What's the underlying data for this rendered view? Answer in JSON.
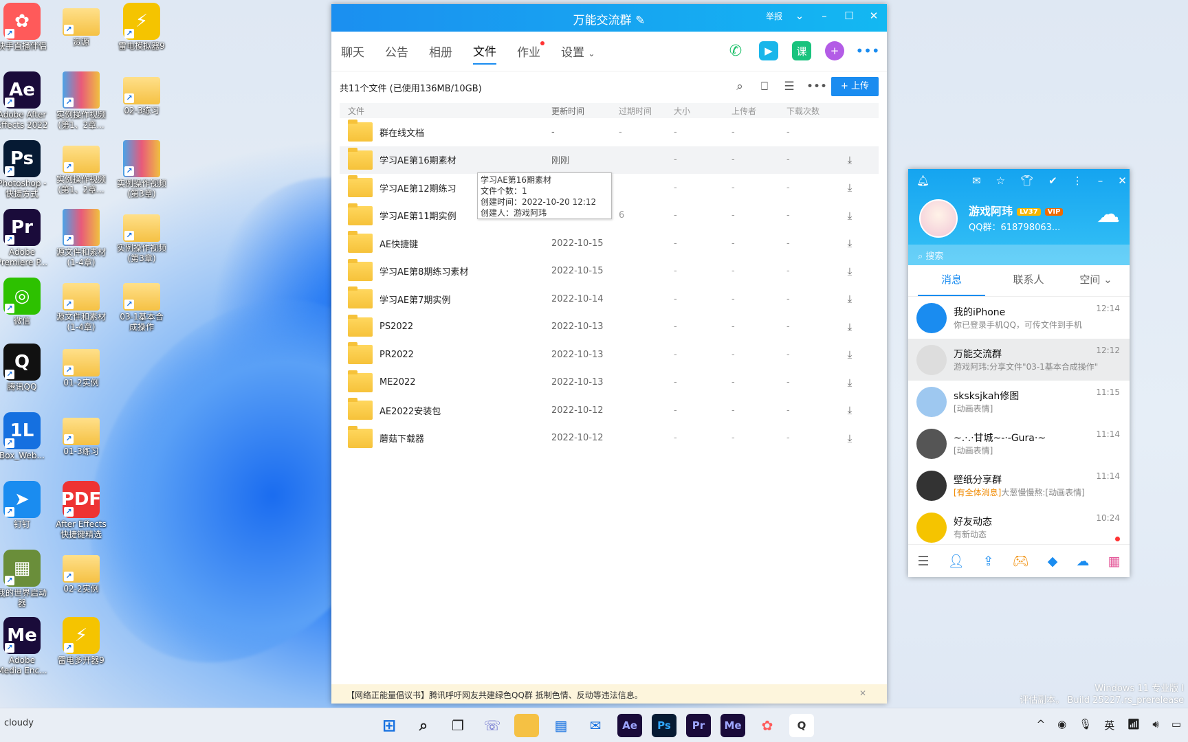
{
  "desktop": {
    "icons": [
      {
        "label": "快手直播伴侣",
        "glyph": "✿",
        "color": "#ff5a5a"
      },
      {
        "label": "资源",
        "glyph": "",
        "color": "folder"
      },
      {
        "label": "雷电模拟器9",
        "glyph": "⚡",
        "color": "#f5c400"
      },
      {
        "label": "Adobe After\nEffects 2022",
        "glyph": "Ae",
        "color": "#1a0b3a"
      },
      {
        "label": "实例操作视频\n(第1、2章...",
        "glyph": "",
        "color": "zip"
      },
      {
        "label": "02-3练习",
        "glyph": "",
        "color": "folder"
      },
      {
        "label": "Photoshop -\n快捷方式",
        "glyph": "Ps",
        "color": "#061a33"
      },
      {
        "label": "实例操作视频\n(第1、2章...",
        "glyph": "",
        "color": "folder"
      },
      {
        "label": "实例操作视频\n(第3章)",
        "glyph": "",
        "color": "zip"
      },
      {
        "label": "Adobe\nPremiere P...",
        "glyph": "Pr",
        "color": "#1a0b3a"
      },
      {
        "label": "源文件和素材\n(1-4章)",
        "glyph": "",
        "color": "zip"
      },
      {
        "label": "实例操作视频\n(第3章)",
        "glyph": "",
        "color": "folder"
      },
      {
        "label": "微信",
        "glyph": "◎",
        "color": "#2dc100"
      },
      {
        "label": "源文件和素材\n(1-4章)",
        "glyph": "",
        "color": "folder"
      },
      {
        "label": "03-1基本合\n成操作",
        "glyph": "",
        "color": "folder"
      },
      {
        "label": "腾讯QQ",
        "glyph": "Q",
        "color": "#111"
      },
      {
        "label": "01-2实例",
        "glyph": "",
        "color": "folder"
      },
      {
        "label": "Box_Web...",
        "glyph": "1L",
        "color": "#1570e0"
      },
      {
        "label": "01-3练习",
        "glyph": "",
        "color": "folder"
      },
      {
        "label": "钉钉",
        "glyph": "➤",
        "color": "#1a8cf0"
      },
      {
        "label": "After Effects\n快捷键精选",
        "glyph": "PDF",
        "color": "#e33"
      },
      {
        "label": "我的世界启动\n器",
        "glyph": "▦",
        "color": "#6a8e3a"
      },
      {
        "label": "02-2实例",
        "glyph": "",
        "color": "folder"
      },
      {
        "label": "Adobe\nMedia Enc...",
        "glyph": "Me",
        "color": "#1a0b3a"
      },
      {
        "label": "雷电多开器9",
        "glyph": "⚡",
        "color": "#f5c400"
      }
    ]
  },
  "window": {
    "title": "万能交流群",
    "report": "举报",
    "tabs": [
      "聊天",
      "公告",
      "相册",
      "文件",
      "作业",
      "设置"
    ],
    "active_tab": "文件",
    "file_count": "共11个文件 (已使用136MB/10GB)",
    "upload_label": "+ 上传",
    "headers": [
      "文件",
      "更新时间",
      "过期时间",
      "大小",
      "上传者",
      "下载次数"
    ],
    "files": [
      {
        "name": "群在线文档",
        "time": "-",
        "expire": "-",
        "size": "-",
        "uploader": "-",
        "downloads": "-",
        "dl": ""
      },
      {
        "name": "学习AE第16期素材",
        "time": "刚刚",
        "expire": "",
        "size": "-",
        "uploader": "-",
        "downloads": "-",
        "dl": "⤓"
      },
      {
        "name": "学习AE第12期练习",
        "time": "",
        "expire": "",
        "size": "-",
        "uploader": "-",
        "downloads": "-",
        "dl": "⤓"
      },
      {
        "name": "学习AE第11期实例",
        "time": "",
        "expire": "6",
        "size": "-",
        "uploader": "-",
        "downloads": "-",
        "dl": "⤓"
      },
      {
        "name": "AE快捷键",
        "time": "2022-10-15",
        "expire": "",
        "size": "-",
        "uploader": "-",
        "downloads": "-",
        "dl": "⤓"
      },
      {
        "name": "学习AE第8期练习素材",
        "time": "2022-10-15",
        "expire": "",
        "size": "-",
        "uploader": "-",
        "downloads": "-",
        "dl": "⤓"
      },
      {
        "name": "学习AE第7期实例",
        "time": "2022-10-14",
        "expire": "",
        "size": "-",
        "uploader": "-",
        "downloads": "-",
        "dl": "⤓"
      },
      {
        "name": "PS2022",
        "time": "2022-10-13",
        "expire": "",
        "size": "-",
        "uploader": "-",
        "downloads": "-",
        "dl": "⤓"
      },
      {
        "name": "PR2022",
        "time": "2022-10-13",
        "expire": "",
        "size": "-",
        "uploader": "-",
        "downloads": "-",
        "dl": "⤓"
      },
      {
        "name": "ME2022",
        "time": "2022-10-13",
        "expire": "",
        "size": "-",
        "uploader": "-",
        "downloads": "-",
        "dl": "⤓"
      },
      {
        "name": "AE2022安装包",
        "time": "2022-10-12",
        "expire": "",
        "size": "-",
        "uploader": "-",
        "downloads": "-",
        "dl": "⤓"
      },
      {
        "name": "蘑菇下载器",
        "time": "2022-10-12",
        "expire": "",
        "size": "-",
        "uploader": "-",
        "downloads": "-",
        "dl": "⤓"
      }
    ],
    "tooltip": [
      "学习AE第16期素材",
      "文件个数：1",
      "创建时间：2022-10-20 12:12",
      "创建人：游戏阿玮"
    ],
    "notice": "【网络正能量倡议书】腾讯呼吁网友共建绿色QQ群 抵制色情、反动等违法信息。"
  },
  "contacts": {
    "name": "游戏阿玮",
    "level": "LV37",
    "vip": "VIP",
    "qq_group": "QQ群：618798063...",
    "search": "搜索",
    "tabs": [
      "消息",
      "联系人",
      "空间"
    ],
    "items": [
      {
        "name": "我的iPhone",
        "preview": "你已登录手机QQ，可传文件到手机",
        "time": "12:14",
        "color": "#1a8cf0"
      },
      {
        "name": "万能交流群",
        "preview": "游戏阿玮:分享文件\"03-1基本合成操作\"",
        "time": "12:12",
        "color": "#ddd"
      },
      {
        "name": "sksksjkah修图",
        "preview": "[动画表情]",
        "time": "11:15",
        "color": "#9ec8f0"
      },
      {
        "name": "~.·.·甘城~-·-Gura·~",
        "preview": "[动画表情]",
        "time": "11:14",
        "color": "#555"
      },
      {
        "name": "壁纸分享群",
        "preview_hl": "[有全体消息]",
        "preview": "大葱慢慢熬:[动画表情]",
        "time": "11:14",
        "color": "#333"
      },
      {
        "name": "好友动态",
        "preview": "有新动态",
        "time": "10:24",
        "color": "#f5c400"
      }
    ]
  },
  "taskbar": {
    "weather": "cloudy",
    "ime": "英",
    "watermark_line1": "Windows 11 专业版 I",
    "watermark_line2": "评估副本。 Build 25227.rs_prerelease"
  }
}
